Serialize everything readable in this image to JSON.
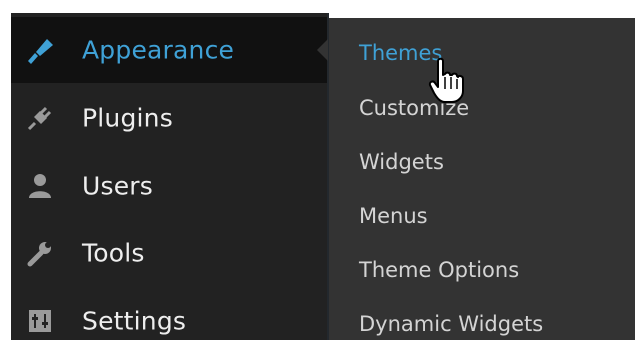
{
  "menu": {
    "items": [
      {
        "label": "Appearance",
        "icon": "paintbrush-icon",
        "active": true
      },
      {
        "label": "Plugins",
        "icon": "plugin-icon",
        "active": false
      },
      {
        "label": "Users",
        "icon": "user-icon",
        "active": false
      },
      {
        "label": "Tools",
        "icon": "wrench-icon",
        "active": false
      },
      {
        "label": "Settings",
        "icon": "settings-icon",
        "active": false
      }
    ]
  },
  "submenu": {
    "items": [
      {
        "label": "Themes",
        "current": true
      },
      {
        "label": "Customize"
      },
      {
        "label": "Widgets"
      },
      {
        "label": "Menus"
      },
      {
        "label": "Theme Options"
      },
      {
        "label": "Dynamic Widgets"
      }
    ]
  },
  "colors": {
    "sidebar_bg": "#222222",
    "submenu_bg": "#333333",
    "active_bg": "#111111",
    "accent": "#3fa1d6",
    "text": "#eeeeee"
  }
}
